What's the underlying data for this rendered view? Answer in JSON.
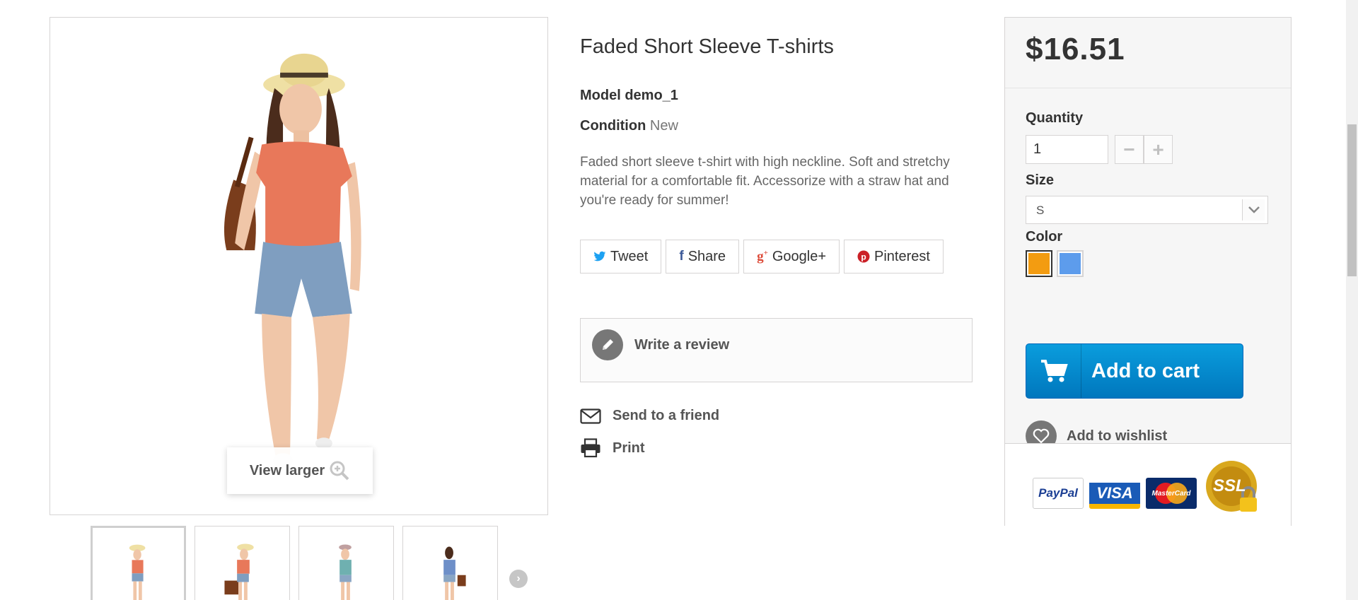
{
  "product": {
    "title": "Faded Short Sleeve T-shirts",
    "model_label": "Model",
    "model_value": "demo_1",
    "condition_label": "Condition",
    "condition_value": "New",
    "description": "Faded short sleeve t-shirt with high neckline. Soft and stretchy material for a comfortable fit. Accessorize with a straw hat and you're ready for summer!"
  },
  "gallery": {
    "view_larger_label": "View larger",
    "thumbnail_count": 4
  },
  "share": {
    "tweet": "Tweet",
    "share": "Share",
    "googleplus": "Google+",
    "pinterest": "Pinterest"
  },
  "review": {
    "write_label": "Write a review"
  },
  "links": {
    "send_friend": "Send to a friend",
    "print": "Print"
  },
  "buybox": {
    "price": "$16.51",
    "quantity_label": "Quantity",
    "quantity_value": "1",
    "size_label": "Size",
    "size_value": "S",
    "color_label": "Color",
    "colors": [
      "#f39c11",
      "#5d9cec"
    ],
    "add_to_cart": "Add to cart",
    "wishlist": "Add to wishlist",
    "payment": {
      "paypal": "PayPal",
      "visa": "VISA",
      "mastercard": "MasterCard",
      "ssl": "SSL"
    }
  }
}
